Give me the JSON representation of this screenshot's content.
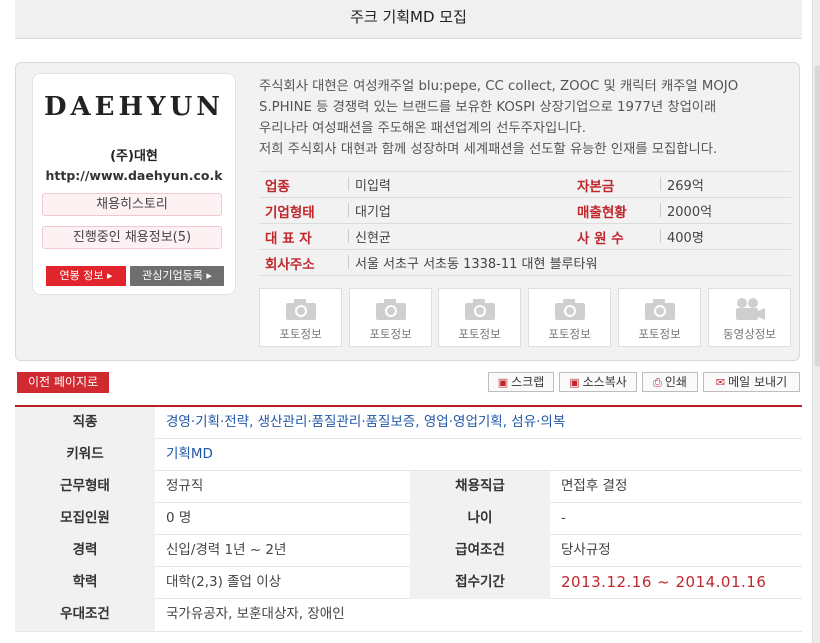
{
  "page_title": "주크 기획MD 모집",
  "company": {
    "logo_text": "DAEHYUN",
    "name": "(주)대현",
    "url": "http://www.daehyun.co.k",
    "history_button": "채용히스토리",
    "ongoing_button": "진행중인 채용정보(5)",
    "salary_button": "연봉 정보",
    "interest_button": "관심기업등록",
    "description_lines": [
      "주식회사 대현은 여성캐주얼 blu:pepe, CC collect, ZOOC 및 캐릭터 캐주얼 MOJO",
      "S.PHINE 등 경쟁력 있는 브랜드를 보유한 KOSPI 상장기업으로 1977년 창업이래",
      "우리나라 여성패션을 주도해온 패션업계의 선두주자입니다.",
      "저희 주식회사 대현과 함께 성장하며 세계패션을 선도할 유능한 인재를 모집합니다."
    ],
    "info": {
      "industry_label": "업종",
      "industry_value": "미입력",
      "capital_label": "자본금",
      "capital_value": "269억",
      "type_label": "기업형태",
      "type_value": "대기업",
      "sales_label": "매출현황",
      "sales_value": "2000억",
      "ceo_label": "대 표 자",
      "ceo_value": "신현균",
      "employees_label": "사 원 수",
      "employees_value": "400명",
      "address_label": "회사주소",
      "address_value": "서울 서초구 서초동 1338-11 대현 블루타워"
    },
    "media": [
      "포토정보",
      "포토정보",
      "포토정보",
      "포토정보",
      "포토정보",
      "동영상정보"
    ]
  },
  "toolbar": {
    "prev_page": "이전 페이지로",
    "scrap": "스크랩",
    "sosu": "소스복사",
    "print": "인쇄",
    "mail": "메일 보내기"
  },
  "details": {
    "job_label": "직종",
    "job_value": "경영·기획·전략, 생산관리·품질관리·품질보증, 영업·영업기획, 섬유·의복",
    "keyword_label": "키워드",
    "keyword_value": "기획MD",
    "worktype_label": "근무형태",
    "worktype_value": "정규직",
    "rank_label": "채용직급",
    "rank_value": "면접후 결정",
    "headcount_label": "모집인원",
    "headcount_value": "0 명",
    "age_label": "나이",
    "age_value": "-",
    "career_label": "경력",
    "career_value": "신입/경력 1년 ~ 2년",
    "pay_label": "급여조건",
    "pay_value": "당사규정",
    "edu_label": "학력",
    "edu_value": "대학(2,3) 졸업 이상",
    "period_label": "접수기간",
    "period_value": "2013.12.16 ~ 2014.01.16",
    "pref_label": "우대조건",
    "pref_value": "국가유공자, 보훈대상자, 장애인"
  },
  "colors": {
    "accent_red": "#c0272d",
    "link_blue": "#2158a8"
  }
}
